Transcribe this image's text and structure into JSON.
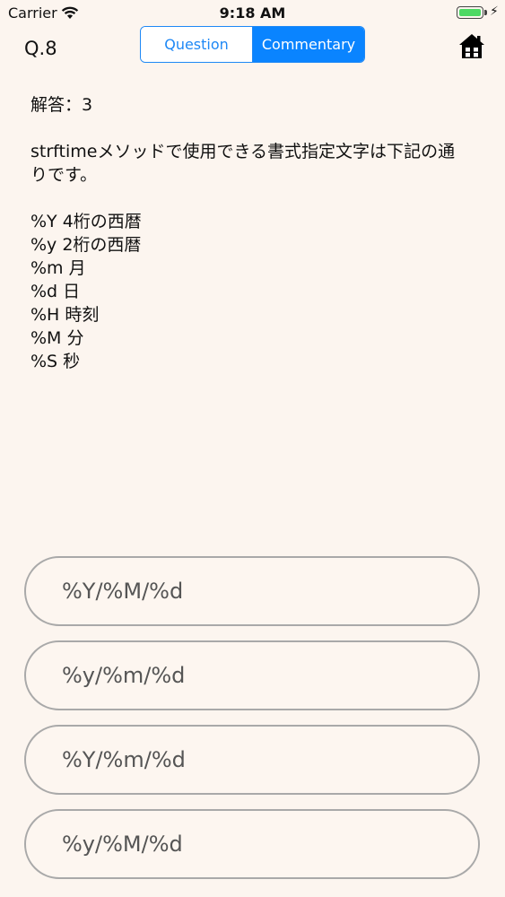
{
  "status_bar": {
    "carrier": "Carrier",
    "time": "9:18 AM",
    "battery_level": 1.0
  },
  "nav": {
    "question_number": "Q.8",
    "tabs": [
      {
        "label": "Question",
        "active": false
      },
      {
        "label": "Commentary",
        "active": true
      }
    ],
    "home_icon": "home-icon"
  },
  "content": {
    "answer": "解答：3",
    "explanation": "strftimeメソッドで使用できる書式指定文字は下記の通りです。",
    "formats": [
      "%Y 4桁の西暦",
      "%y 2桁の西暦",
      "%m 月",
      "%d 日",
      "%H 時刻",
      "%M 分",
      "%S 秒"
    ]
  },
  "choices": [
    "%Y/%M/%d",
    "%y/%m/%d",
    "%Y/%m/%d",
    "%y/%M/%d"
  ],
  "colors": {
    "accent": "#0a84ff",
    "background": "#fcf5ef",
    "choice_border": "#a9a9a9",
    "battery": "#4cd964"
  }
}
